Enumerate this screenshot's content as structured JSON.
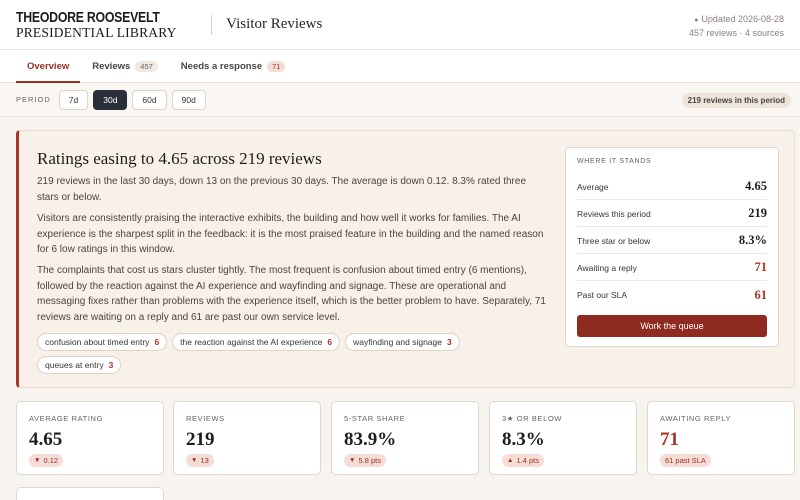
{
  "brand": {
    "line1": "THEODORE ROOSEVELT",
    "line2": "PRESIDENTIAL LIBRARY"
  },
  "header": {
    "title": "Visitor Reviews",
    "updated": "Updated 2026-08-28",
    "meta": "457 reviews · 4 sources"
  },
  "tabs": [
    {
      "label": "Overview",
      "count": ""
    },
    {
      "label": "Reviews",
      "count": "457"
    },
    {
      "label": "Needs a response",
      "count": "71"
    }
  ],
  "period": {
    "label": "PERIOD",
    "options": [
      "7d",
      "30d",
      "60d",
      "90d"
    ],
    "selected": "30d",
    "pill": "219 reviews in this period"
  },
  "summary": {
    "title": "Ratings easing to 4.65 across 219 reviews",
    "p1": "219 reviews in the last 30 days, down 13 on the previous 30 days. The average is down 0.12. 8.3% rated three stars or below.",
    "p2": "Visitors are consistently praising the interactive exhibits, the building and how well it works for families. The AI experience is the sharpest split in the feedback: it is the most praised feature in the building and the named reason for 6 low ratings in this window.",
    "p3": "The complaints that cost us stars cluster tightly. The most frequent is confusion about timed entry (6 mentions), followed by the reaction against the AI experience and wayfinding and signage. These are operational and messaging fixes rather than problems with the experience itself, which is the better problem to have. Separately, 71 reviews are waiting on a reply and 61 are past our own service level.",
    "chips": [
      {
        "label": "confusion about timed entry",
        "n": "6"
      },
      {
        "label": "the reaction against the AI experience",
        "n": "6"
      },
      {
        "label": "wayfinding and signage",
        "n": "3"
      },
      {
        "label": "queues at entry",
        "n": "3"
      }
    ]
  },
  "stands": {
    "title": "WHERE IT STANDS",
    "rows": [
      {
        "label": "Average",
        "value": "4.65"
      },
      {
        "label": "Reviews this period",
        "value": "219"
      },
      {
        "label": "Three star or below",
        "value": "8.3%"
      },
      {
        "label": "Awaiting a reply",
        "value": "71"
      },
      {
        "label": "Past our SLA",
        "value": "61"
      }
    ],
    "button": "Work the queue"
  },
  "kpis": [
    {
      "label": "AVERAGE RATING",
      "value": "4.65",
      "arrow": "▼",
      "delta": "0.12"
    },
    {
      "label": "REVIEWS",
      "value": "219",
      "arrow": "▼",
      "delta": "13"
    },
    {
      "label": "5-STAR SHARE",
      "value": "83.9%",
      "arrow": "▼",
      "delta": "5.8 pts"
    },
    {
      "label": "3★ OR BELOW",
      "value": "8.3%",
      "arrow": "▲",
      "delta": "1.4 pts"
    },
    {
      "label": "AWAITING REPLY",
      "value": "71",
      "arrow": "",
      "delta": "61 past SLA"
    }
  ],
  "colors": {
    "accent": "#9a2f22",
    "button": "#8f2a20",
    "dark": "#2a2f3a",
    "background": "#f7f3ee"
  }
}
